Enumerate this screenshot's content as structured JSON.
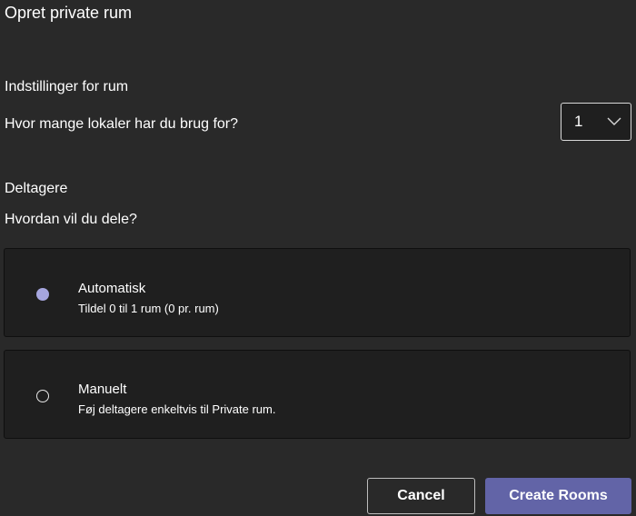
{
  "dialog": {
    "title": "Opret private rum"
  },
  "settings": {
    "heading": "Indstillinger for rum",
    "rooms_question": "Hvor mange lokaler har du brug for?",
    "rooms_selected": "1"
  },
  "participants": {
    "heading": "Deltagere",
    "share_question": "Hvordan vil du dele?",
    "options": [
      {
        "title": "Automatisk",
        "description": "Tildel 0 til 1 rum (0 pr. rum)",
        "selected": true
      },
      {
        "title": "Manuelt",
        "description": "Føj deltagere enkeltvis til Private rum.",
        "selected": false
      }
    ]
  },
  "actions": {
    "cancel_label": "Cancel",
    "create_label": "Create Rooms"
  },
  "colors": {
    "background": "#292929",
    "card_background": "#1f1f1f",
    "accent": "#6264a7",
    "radio_selected": "#a6a6df"
  },
  "icons": {
    "dropdown": "chevron-down-icon",
    "radio_on": "radio-selected-icon",
    "radio_off": "radio-unselected-icon"
  }
}
